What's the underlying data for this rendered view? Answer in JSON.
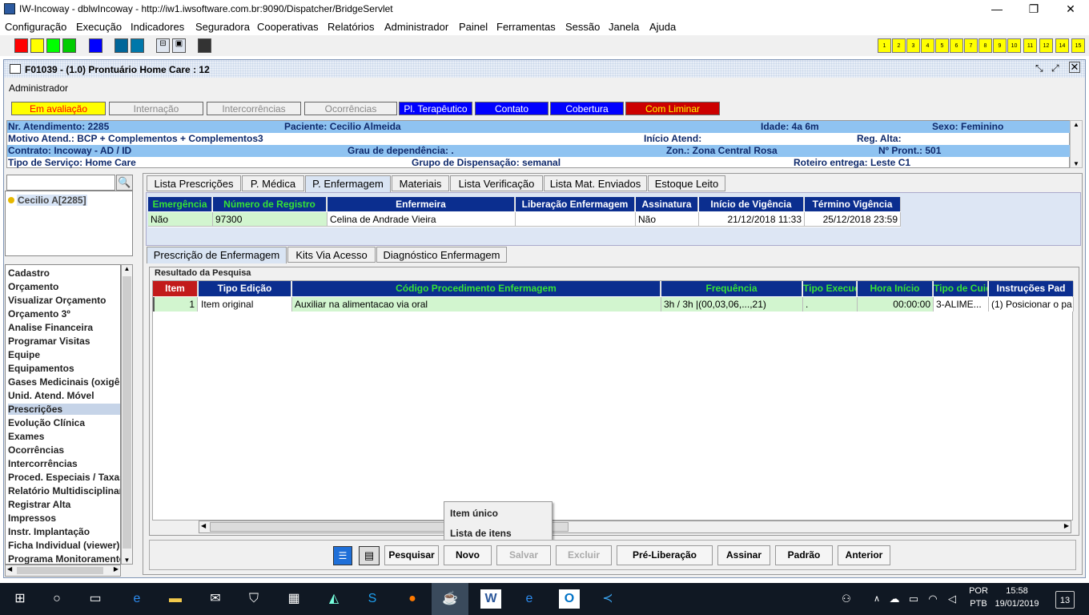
{
  "window": {
    "title": "IW-Incoway - dblwIncoway - http://iw1.iwsoftware.com.br:9090/Dispatcher/BridgeServlet",
    "minimize": "—",
    "maximize": "❐",
    "close": "✕"
  },
  "menubar": [
    "Configuração",
    "Execução",
    "Indicadores",
    "Seguradora",
    "Cooperativas",
    "Relatórios",
    "Administrador",
    "Painel",
    "Ferramentas",
    "Sessão",
    "Janela",
    "Ajuda"
  ],
  "toolbar": {
    "colors": [
      "#ff0000",
      "#ffff00",
      "#00ff00",
      "#00cc00",
      "#0000ff",
      "#006699",
      "#0077aa",
      "#333333"
    ],
    "numbers": [
      "1",
      "2",
      "3",
      "4",
      "5",
      "6",
      "7",
      "8",
      "9",
      "10",
      "11",
      "12",
      "14",
      "15"
    ]
  },
  "frame": {
    "title": "F01039 - (1.0) Prontuário Home Care : 12",
    "user": "Administrador"
  },
  "status": [
    {
      "label": "Em avaliação",
      "bg": "#ffff00",
      "color": "#ff0000"
    },
    {
      "label": "Internação",
      "bg": "#f0f0f0",
      "color": "#888888"
    },
    {
      "label": "Intercorrências",
      "bg": "#f0f0f0",
      "color": "#888888"
    },
    {
      "label": "Ocorrências",
      "bg": "#f0f0f0",
      "color": "#888888"
    },
    {
      "label": "Pl. Terapêutico",
      "bg": "#0000ff",
      "color": "#ffffff"
    },
    {
      "label": "Contato",
      "bg": "#0000ff",
      "color": "#ffffff"
    },
    {
      "label": "Cobertura",
      "bg": "#0000ff",
      "color": "#ffffff"
    },
    {
      "label": "Com Liminar",
      "bg": "#cc0000",
      "color": "#ffff00"
    }
  ],
  "patient": {
    "row1": [
      "Nr. Atendimento: 2285",
      "Paciente: Cecilio Almeida",
      "Idade: 4a 6m",
      "Sexo: Feminino"
    ],
    "row2": [
      "Motivo Atend.: BCP + Complementos + Complementos3",
      "Início Atend:",
      "Reg. Alta:"
    ],
    "row3": [
      "Contrato: Incoway - AD / ID",
      "Grau de dependência: .",
      "Zon.: Zona Central Rosa",
      "Nº Pront.: 501"
    ],
    "row4": [
      "Tipo de Serviço: Home Care",
      "Grupo de Dispensação: semanal",
      "Roteiro entrega: Leste C1"
    ]
  },
  "tree": {
    "item": "Cecilio A[2285]"
  },
  "sidemenu": [
    "Cadastro",
    "Orçamento",
    "Visualizar Orçamento",
    "Orçamento 3º",
    "Analise Financeira",
    "Programar Visitas",
    "Equipe",
    "Equipamentos",
    "Gases Medicinais (oxigênio)",
    "Unid. Atend. Móvel",
    "Prescrições",
    "Evolução Clínica",
    "Exames",
    "Ocorrências",
    "Intercorrências",
    "Proced. Especiais / Taxas",
    "Relatório Multidisciplinar",
    "Registrar Alta",
    "Impressos",
    "Instr. Implantação",
    "Ficha Individual (viewer)",
    "Programa Monitoramento"
  ],
  "tabs": [
    "Lista Prescrições",
    "P. Médica",
    "P. Enfermagem",
    "Materiais",
    "Lista Verificação",
    "Lista Mat. Enviados",
    "Estoque Leito"
  ],
  "enf": {
    "headers": [
      "Emergência",
      "Número de Registro",
      "Enfermeira",
      "Liberação Enfermagem",
      "Assinatura",
      "Início de Vigência",
      "Término Vigência"
    ],
    "row": [
      "Não",
      "97300",
      "Celina de Andrade Vieira",
      "",
      "Não",
      "21/12/2018 11:33",
      "25/12/2018 23:59"
    ]
  },
  "subtabs": [
    "Prescrição de Enfermagem",
    "Kits Via Acesso",
    "Diagnóstico Enfermagem"
  ],
  "result": {
    "title": "Resultado da Pesquisa",
    "headers": [
      "Item",
      "Tipo Edição",
      "Código Procedimento Enfermagem",
      "Frequência",
      "Tipo Execuç",
      "Hora Início",
      "Tipo de Cuid",
      "Instruções Pad"
    ],
    "row": [
      "1",
      "Item original",
      "Auxiliar na alimentacao via oral",
      "3h / 3h |(00,03,06,...,21)",
      ".",
      "00:00:00",
      "3-ALIME...",
      "(1) Posicionar o pa"
    ]
  },
  "popup": [
    "Item único",
    "Lista de itens"
  ],
  "buttons": [
    "Pesquisar",
    "Novo",
    "Salvar",
    "Excluir",
    "Pré-Liberação",
    "Assinar",
    "Padrão",
    "Anterior"
  ],
  "taskbar": {
    "lang1": "POR",
    "lang2": "PTB",
    "time": "15:58",
    "date": "19/01/2019",
    "notif": "13"
  }
}
